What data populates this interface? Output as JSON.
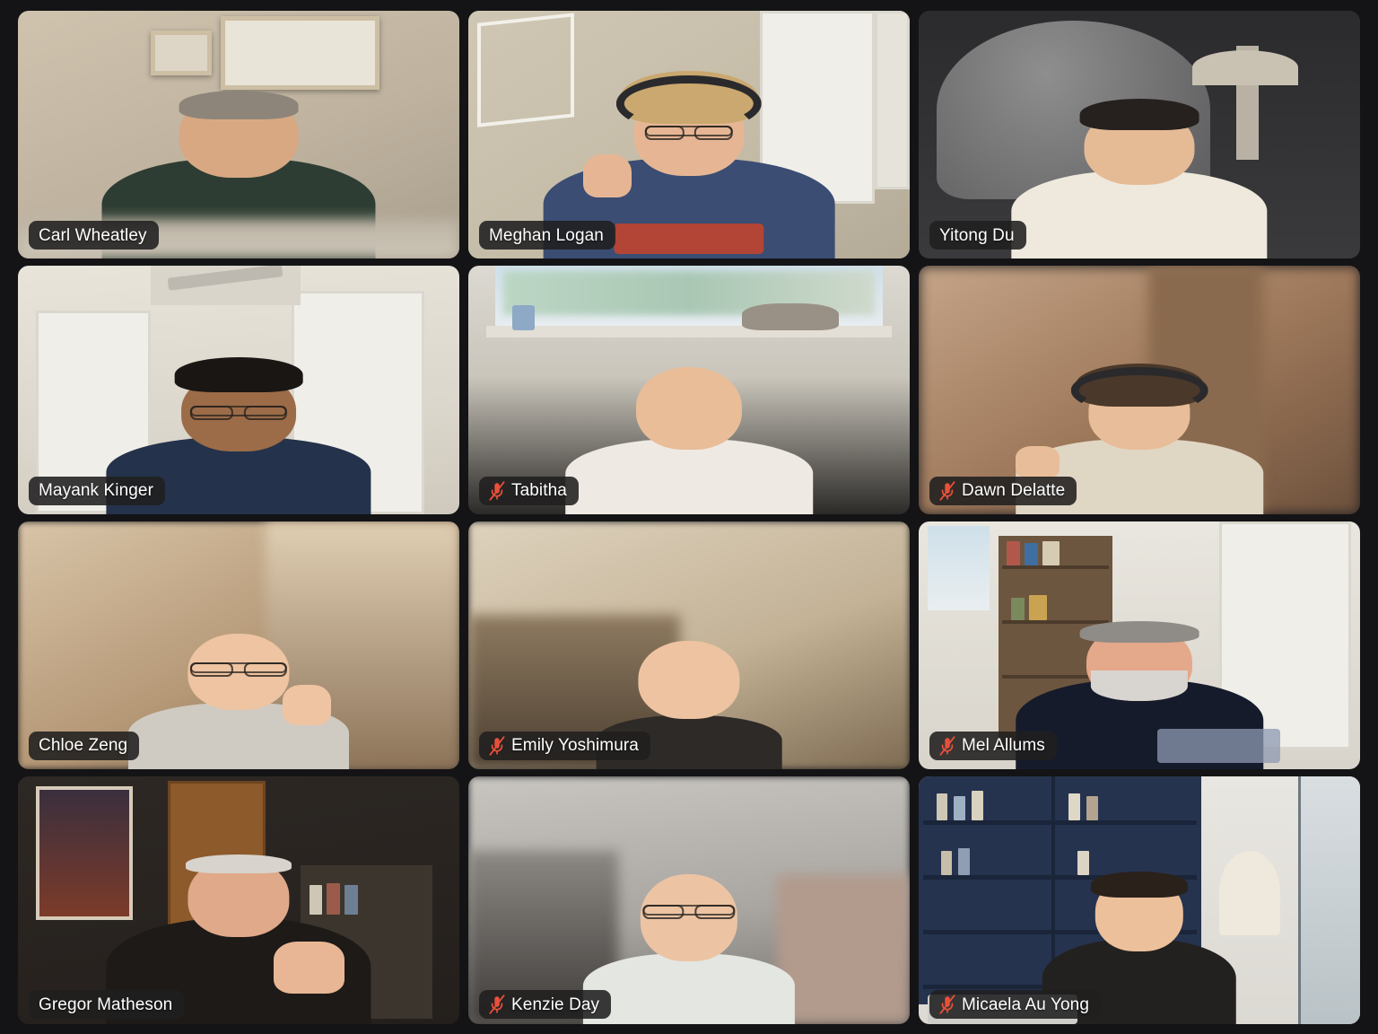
{
  "app": {
    "name": "video-conference-gallery",
    "layout": "gallery-grid",
    "columns": 3,
    "rows": 4,
    "participant_count": 12,
    "background_color": "#141416",
    "active_speaker_border_color": "#7DE08D",
    "badge_background_color": "#201F1F",
    "muted_icon_color": "#E8503A"
  },
  "participants": [
    {
      "name": "Carl Wheatley",
      "muted": false,
      "active_speaker": false,
      "position": "row1-col1"
    },
    {
      "name": "Meghan Logan",
      "muted": false,
      "active_speaker": true,
      "position": "row1-col2"
    },
    {
      "name": "Yitong Du",
      "muted": false,
      "active_speaker": false,
      "position": "row1-col3"
    },
    {
      "name": "Mayank Kinger",
      "muted": false,
      "active_speaker": false,
      "position": "row2-col1"
    },
    {
      "name": "Tabitha",
      "muted": true,
      "active_speaker": false,
      "position": "row2-col2"
    },
    {
      "name": "Dawn Delatte",
      "muted": true,
      "active_speaker": false,
      "position": "row2-col3"
    },
    {
      "name": "Chloe Zeng",
      "muted": false,
      "active_speaker": false,
      "position": "row3-col1"
    },
    {
      "name": "Emily Yoshimura",
      "muted": true,
      "active_speaker": false,
      "position": "row3-col2"
    },
    {
      "name": "Mel Allums",
      "muted": true,
      "active_speaker": false,
      "position": "row3-col3"
    },
    {
      "name": "Gregor Matheson",
      "muted": false,
      "active_speaker": false,
      "position": "row4-col1"
    },
    {
      "name": "Kenzie Day",
      "muted": true,
      "active_speaker": false,
      "position": "row4-col2"
    },
    {
      "name": "Micaela Au Yong",
      "muted": true,
      "active_speaker": false,
      "position": "row4-col3"
    }
  ],
  "icons": {
    "mic_muted": "microphone-muted-icon"
  }
}
